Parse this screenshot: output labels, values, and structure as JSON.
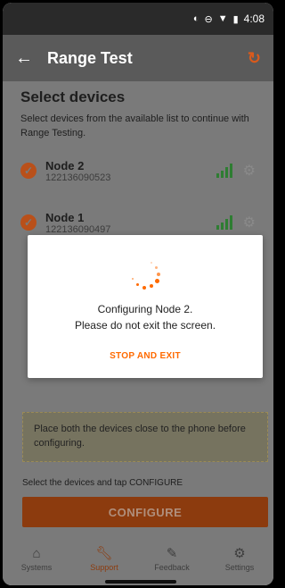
{
  "status": {
    "time": "4:08"
  },
  "appbar": {
    "title": "Range Test"
  },
  "section": {
    "title": "Select devices",
    "subtitle": "Select devices from the available list to continue with Range Testing."
  },
  "devices": [
    {
      "name": "Node 2",
      "id": "122136090523"
    },
    {
      "name": "Node 1",
      "id": "122136090497"
    }
  ],
  "modal": {
    "line1": "Configuring Node 2.",
    "line2": "Please do not exit the screen.",
    "action": "STOP AND EXIT"
  },
  "hint": {
    "text": "Place both the devices close to the phone before configuring."
  },
  "footer": {
    "instruction": "Select the devices and tap CONFIGURE",
    "configure_label": "CONFIGURE"
  },
  "nav": [
    {
      "label": "Systems",
      "icon": "home-icon"
    },
    {
      "label": "Support",
      "icon": "wrench-icon"
    },
    {
      "label": "Feedback",
      "icon": "feedback-icon"
    },
    {
      "label": "Settings",
      "icon": "gear-icon"
    }
  ],
  "colors": {
    "accent": "#ff6a00",
    "signal": "#2e7d32"
  }
}
